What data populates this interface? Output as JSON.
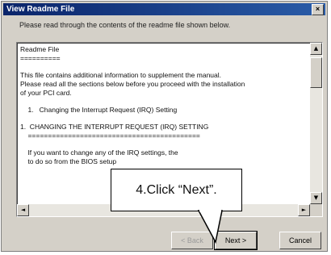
{
  "window": {
    "title": "View Readme File",
    "close_glyph": "×"
  },
  "instruction": "Please read through the contents of the readme file shown below.",
  "readme": {
    "lines": [
      "Readme File",
      "==========",
      "",
      "This file contains additional information to supplement the manual.",
      "Please read all the sections below before you proceed with the installation",
      "of your PCI card.",
      "",
      "    1.   Changing the Interrupt Request (IRQ) Setting",
      "",
      "1.  CHANGING THE INTERRUPT REQUEST (IRQ) SETTING",
      "    ===========================================",
      "",
      "    If you want to change any of the IRQ settings, the",
      "    to do so from the BIOS setup"
    ]
  },
  "scrollbars": {
    "up": "▲",
    "down": "▼",
    "left": "◄",
    "right": "►"
  },
  "buttons": {
    "back": "< Back",
    "next": "Next >",
    "cancel": "Cancel"
  },
  "callout": {
    "text": "4.Click “Next”."
  },
  "colors": {
    "title_bar": "#0a246a",
    "dialog_face": "#d4d0c8"
  }
}
